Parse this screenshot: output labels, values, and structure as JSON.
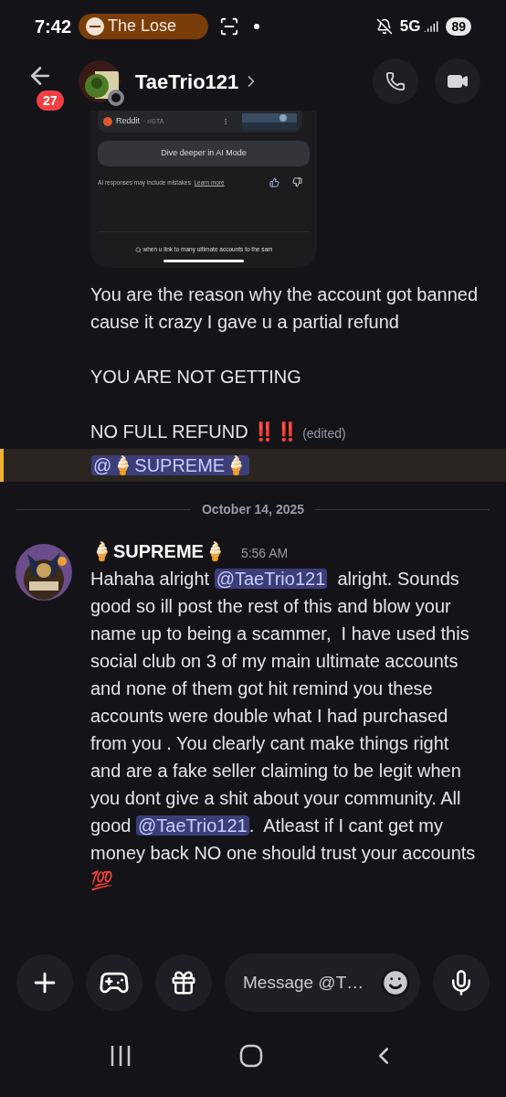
{
  "status_bar": {
    "time": "7:42",
    "media_pill": "The Lose",
    "network": "5G",
    "battery": "89"
  },
  "header": {
    "unread_badge": "27",
    "title": "TaeTrio121",
    "online": false
  },
  "attachment": {
    "source": "Reddit",
    "source_detail": "· r/GTA",
    "button": "Dive deeper in AI Mode",
    "disclaimer": "AI responses may include mistakes.",
    "link": "Learn more",
    "search_query": "when u link to many ultimate accounts to the sam"
  },
  "earlier_message": {
    "paragraphs": [
      "You are the reason why the account got banned cause it crazy I gave u a partial refund",
      "YOU ARE NOT GETTING",
      "NO FULL REFUND ‼️‼️"
    ],
    "edited": "(edited)"
  },
  "mention_message": {
    "mention": "@🍦SUPREME🍦",
    "highlighted": true
  },
  "date_divider": "October 14, 2025",
  "message": {
    "author": "🍦SUPREME🍦",
    "time": "5:56 AM",
    "parts": [
      {
        "kind": "text",
        "text": "Hahaha alright "
      },
      {
        "kind": "mention",
        "text": "@TaeTrio121"
      },
      {
        "kind": "text",
        "text": "  alright. Sounds good so ill post the rest of this and blow your name up to being a scammer,  I have used this social club on 3 of my main ultimate accounts and none of them got hit remind you these accounts were double what I had purchased from you . You clearly cant make things right and are a fake seller claiming to be legit when you dont give a shit about your community. All good "
      },
      {
        "kind": "mention",
        "text": "@TaeTrio121"
      },
      {
        "kind": "text",
        "text": ".  Atleast if I cant get my money back NO one should trust your accounts 💯"
      }
    ]
  },
  "composer": {
    "placeholder": "Message @T…"
  }
}
